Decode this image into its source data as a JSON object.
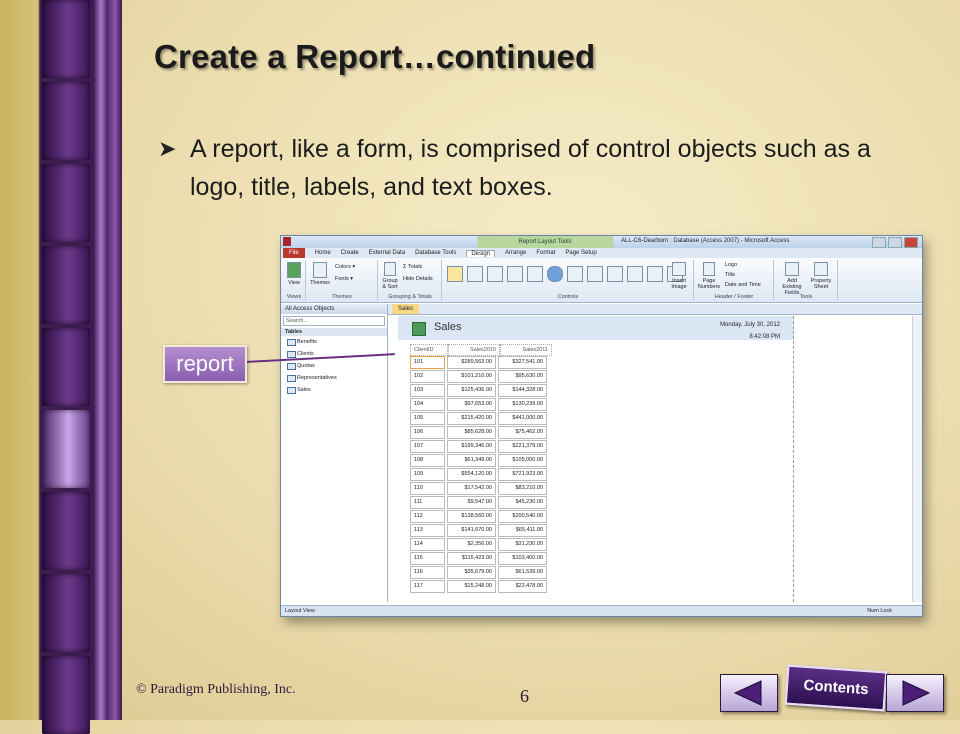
{
  "slide": {
    "title": "Create a Report…continued",
    "bullet": "A report, like a form, is comprised of control objects such as a logo, title, labels, and text boxes.",
    "callout": "report",
    "footer": "© Paradigm Publishing, Inc.",
    "page_number": "6",
    "contents_button": "Contents"
  },
  "access": {
    "context_tab": "Report Layout Tools",
    "window_title": "ALL-C6-Dearborn : Database (Access 2007) - Microsoft Access",
    "tabs": [
      "File",
      "Home",
      "Create",
      "External Data",
      "Database Tools",
      "Design",
      "Arrange",
      "Format",
      "Page Setup"
    ],
    "ribbon_groups": {
      "views": "Views",
      "themes": "Themes",
      "grouping": "Grouping & Totals",
      "controls": "Controls",
      "header_footer": "Header / Footer",
      "tools": "Tools"
    },
    "ribbon_buttons": {
      "view": "View",
      "themes": "Themes",
      "colors": "Colors",
      "fonts": "Fonts",
      "group_sort": "Group & Sort",
      "totals": "Σ Totals",
      "hide_details": "Hide Details",
      "insert_image": "Insert Image",
      "page_numbers": "Page Numbers",
      "logo": "Logo",
      "title": "Title",
      "date_time": "Date and Time",
      "add_fields": "Add Existing Fields",
      "property_sheet": "Property Sheet"
    },
    "nav": {
      "header": "All Access Objects",
      "search_placeholder": "Search...",
      "section": "Tables",
      "items": [
        "Benefits",
        "Clients",
        "Quotas",
        "Representatives",
        "Sales"
      ]
    },
    "doc_tab": "Sales",
    "report": {
      "title": "Sales",
      "date": "Monday, July 30, 2012",
      "time": "8:42:08 PM",
      "columns": [
        "ClientID",
        "Sales2010",
        "Sales2011"
      ],
      "rows": [
        [
          "101",
          "$289,563.00",
          "$327,541.00"
        ],
        [
          "102",
          "$101,210.00",
          "$95,630.00"
        ],
        [
          "103",
          "$125,436.00",
          "$144,328.00"
        ],
        [
          "104",
          "$97,653.00",
          "$130,239.00"
        ],
        [
          "105",
          "$215,420.00",
          "$441,000.00"
        ],
        [
          "106",
          "$85,628.00",
          "$75,462.00"
        ],
        [
          "107",
          "$199,346.00",
          "$221,379.00"
        ],
        [
          "108",
          "$61,349.00",
          "$105,000.00"
        ],
        [
          "109",
          "$554,120.00",
          "$721,923.00"
        ],
        [
          "110",
          "$17,542.00",
          "$83,210.00"
        ],
        [
          "111",
          "$9,547.00",
          "$45,230.00"
        ],
        [
          "112",
          "$138,560.00",
          "$200,540.00"
        ],
        [
          "113",
          "$141,670.00",
          "$65,411.00"
        ],
        [
          "114",
          "$2,356.00",
          "$31,230.00"
        ],
        [
          "115",
          "$115,423.00",
          "$103,400.00"
        ],
        [
          "116",
          "$35,679.00",
          "$61,539.00"
        ],
        [
          "117",
          "$15,248.00",
          "$22,478.00"
        ]
      ]
    },
    "status_left": "Layout View",
    "status_right": "Num Lock"
  }
}
